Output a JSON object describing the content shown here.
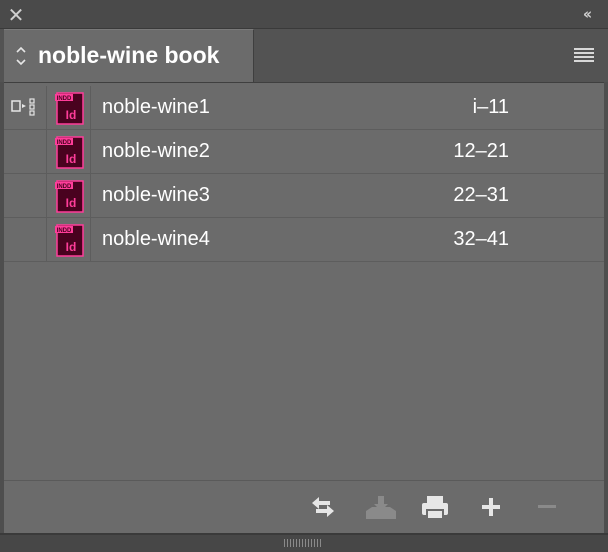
{
  "window": {
    "close_glyph": "✕",
    "collapse_glyph": "‹‹"
  },
  "tab": {
    "title": "noble-wine book",
    "arrows_glyph": "⌃⌄",
    "menu_icon": "panel-menu-icon"
  },
  "documents": [
    {
      "name": "noble-wine1",
      "pages": "i–11",
      "is_style_source": true,
      "icon": "indd-file-icon",
      "icon_label": "Id",
      "icon_tag": "INDD"
    },
    {
      "name": "noble-wine2",
      "pages": "12–21",
      "is_style_source": false,
      "icon": "indd-file-icon",
      "icon_label": "Id",
      "icon_tag": "INDD"
    },
    {
      "name": "noble-wine3",
      "pages": "22–31",
      "is_style_source": false,
      "icon": "indd-file-icon",
      "icon_label": "Id",
      "icon_tag": "INDD"
    },
    {
      "name": "noble-wine4",
      "pages": "32–41",
      "is_style_source": false,
      "icon": "indd-file-icon",
      "icon_label": "Id",
      "icon_tag": "INDD"
    }
  ],
  "footer": {
    "buttons": [
      {
        "icon": "synchronize-icon",
        "enabled": true
      },
      {
        "icon": "save-book-icon",
        "enabled": false
      },
      {
        "icon": "print-icon",
        "enabled": true
      },
      {
        "icon": "add-document-icon",
        "enabled": true
      },
      {
        "icon": "remove-document-icon",
        "enabled": false
      }
    ]
  },
  "colors": {
    "panel_bg": "#6b6b6b",
    "chrome_bg": "#4e4e4e",
    "indd_icon_bg": "#49021f",
    "indd_icon_accent": "#ff3d9a",
    "text": "#ffffff",
    "disabled_icon": "#8a8a8a"
  }
}
